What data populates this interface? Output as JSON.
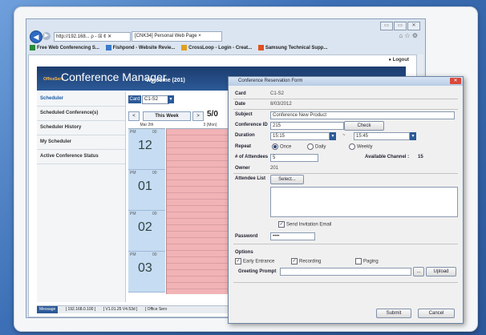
{
  "browser": {
    "address": "http://192.168... ρ - ☒ ¢ ✕",
    "tab_title": "[CNK34] Personal Web Page ×",
    "favorites": [
      "Free Web Conferencing S...",
      "Fishpond - Website Revie...",
      "CrossLoop - Login - Creat...",
      "Samsung Technical Supp..."
    ],
    "window_buttons": [
      "▭",
      "▭",
      "✕"
    ],
    "tool_icons": "⌂ ☆ ⚙"
  },
  "app": {
    "logout": "Logout",
    "brand_small": "OfficeServ",
    "brand_title": "Conference Manager",
    "welcome": "Welcome  (201)"
  },
  "sidebar": {
    "items": [
      {
        "label": "Scheduler"
      },
      {
        "label": "Scheduled Conference(s)"
      },
      {
        "label": "Scheduler History"
      },
      {
        "label": "My Scheduler"
      },
      {
        "label": "Active Conference Status"
      }
    ]
  },
  "scheduler": {
    "card_label": "Card",
    "card_value": "C1-S2",
    "prev": "<",
    "this_week": "This Week",
    "next": ">",
    "date_prefix": "5/0",
    "day_headers": [
      "Mar 2th",
      "3 (Mon)"
    ],
    "hours": [
      {
        "ampm": "PM",
        "mm": "00",
        "hh": "12"
      },
      {
        "ampm": "PM",
        "mm": "00",
        "hh": "01"
      },
      {
        "ampm": "PM",
        "mm": "00",
        "hh": "02"
      },
      {
        "ampm": "PM",
        "mm": "00",
        "hh": "03"
      }
    ]
  },
  "status_bar": {
    "message_tag": "Message",
    "ip": "[ 192.168.0.100 ]",
    "version": "[ V1.01.25 V4.53d ]",
    "office": "[ Office Serv"
  },
  "dialog": {
    "title": "Conference Reservation Form",
    "close": "✕",
    "card_label": "Card",
    "card_value": "C1-S2",
    "date_label": "Date",
    "date_value": "8/03/2012",
    "subject_label": "Subject",
    "subject_value": "Conference New Product",
    "conf_id_label": "Conference ID",
    "conf_id_value": "215",
    "check_button": "Check",
    "duration_label": "Duration",
    "duration_from": "15:15",
    "duration_sep": "~",
    "duration_to": "15:45",
    "repeat_label": "Repeat",
    "repeat_options": [
      "Once",
      "Daily",
      "Weekly"
    ],
    "attendees_label": "# of Attendees",
    "attendees_value": "5",
    "available_label": "Available Channel :",
    "available_value": "15",
    "owner_label": "Owner",
    "owner_value": "201",
    "attendee_list_label": "Attendee List",
    "select_button": "Select...",
    "send_email_label": "Send Invitation Email",
    "password_label": "Password",
    "password_value": "••••",
    "options_label": "Options",
    "early_entrance": "Early Entrance",
    "recording": "Recording",
    "paging": "Paging",
    "greeting_label": "Greeting Prompt",
    "greeting_value": "",
    "browse_button": "...",
    "upload_button": "Upload",
    "submit_button": "Submit",
    "cancel_button": "Cancel"
  },
  "colors": {
    "banner": "#1c3c6e",
    "slot_pink": "#f2b3b6",
    "hour_blue": "#c5dcf2",
    "busy_red": "#e22222"
  }
}
